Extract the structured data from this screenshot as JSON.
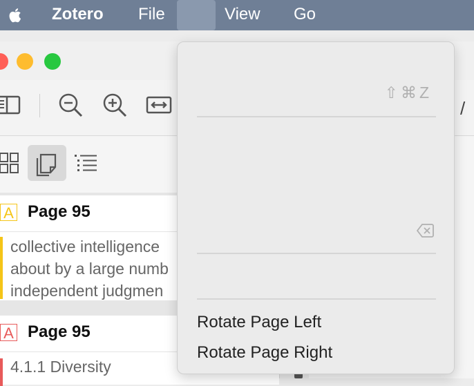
{
  "menubar": {
    "apple_icon": "apple-icon",
    "app_name": "Zotero",
    "items": [
      "File",
      "",
      "View",
      "Go"
    ]
  },
  "window": {
    "traffic_colors": [
      "#ff5f57",
      "#febc2e",
      "#28c840"
    ],
    "toolbar_icons": [
      "sidebar-toggle-icon",
      "zoom-out-icon",
      "zoom-in-icon",
      "fit-width-icon"
    ],
    "page_separator": "/"
  },
  "sidebar": {
    "view_buttons": [
      "thumbnails-icon",
      "annotations-icon",
      "outline-icon"
    ],
    "annotations": [
      {
        "page": "Page 95",
        "tag": "A",
        "color": "#f5c518",
        "lines": [
          "collective intelligence",
          "about by a large numb",
          "independent judgmen"
        ]
      },
      {
        "page": "Page 95",
        "tag": "A",
        "color": "#e85a5a",
        "lines": [
          "4.1.1 Diversity"
        ]
      }
    ]
  },
  "menu": {
    "shortcut": "⇧⌘Z",
    "clear_icon": "clear-field-icon",
    "items": [
      "Rotate Page Left",
      "Rotate Page Right"
    ]
  }
}
